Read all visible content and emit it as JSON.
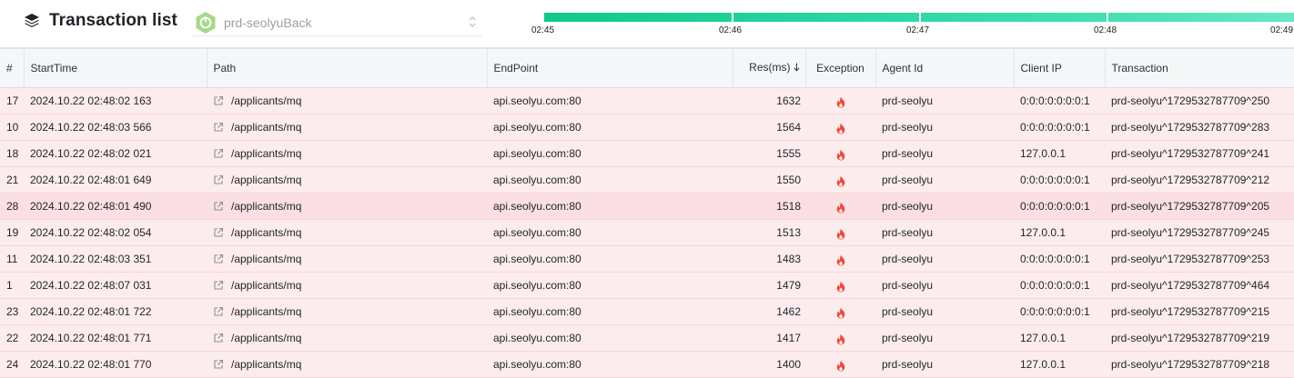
{
  "header": {
    "title": "Transaction list",
    "title_icon": "layers-icon",
    "app_name": "prd-seolyuBack",
    "app_icon": "spring-boot-icon"
  },
  "timeline": {
    "ticks": [
      "02:45",
      "02:46",
      "02:47",
      "02:48",
      "02:49"
    ],
    "colors": [
      "#10c88d",
      "#20d09a",
      "#30d9a6",
      "#45e0b2",
      "#66e8c4"
    ]
  },
  "table": {
    "columns": [
      "#",
      "StartTime",
      "Path",
      "EndPoint",
      "Res(ms)",
      "Exception",
      "Agent Id",
      "Client IP",
      "Transaction"
    ],
    "sort_icon": "arrow-down-icon",
    "rows": [
      {
        "id": "17",
        "start": "2024.10.22 02:48:02 163",
        "path": "/applicants/mq",
        "endpoint": "api.seolyu.com:80",
        "res": "1632",
        "agent": "prd-seolyu",
        "ip": "0:0:0:0:0:0:0:1",
        "tx": "prd-seolyu^1729532787709^250"
      },
      {
        "id": "10",
        "start": "2024.10.22 02:48:03 566",
        "path": "/applicants/mq",
        "endpoint": "api.seolyu.com:80",
        "res": "1564",
        "agent": "prd-seolyu",
        "ip": "0:0:0:0:0:0:0:1",
        "tx": "prd-seolyu^1729532787709^283"
      },
      {
        "id": "18",
        "start": "2024.10.22 02:48:02 021",
        "path": "/applicants/mq",
        "endpoint": "api.seolyu.com:80",
        "res": "1555",
        "agent": "prd-seolyu",
        "ip": "127.0.0.1",
        "tx": "prd-seolyu^1729532787709^241"
      },
      {
        "id": "21",
        "start": "2024.10.22 02:48:01 649",
        "path": "/applicants/mq",
        "endpoint": "api.seolyu.com:80",
        "res": "1550",
        "agent": "prd-seolyu",
        "ip": "0:0:0:0:0:0:0:1",
        "tx": "prd-seolyu^1729532787709^212"
      },
      {
        "id": "28",
        "start": "2024.10.22 02:48:01 490",
        "path": "/applicants/mq",
        "endpoint": "api.seolyu.com:80",
        "res": "1518",
        "agent": "prd-seolyu",
        "ip": "0:0:0:0:0:0:0:1",
        "tx": "prd-seolyu^1729532787709^205"
      },
      {
        "id": "19",
        "start": "2024.10.22 02:48:02 054",
        "path": "/applicants/mq",
        "endpoint": "api.seolyu.com:80",
        "res": "1513",
        "agent": "prd-seolyu",
        "ip": "127.0.0.1",
        "tx": "prd-seolyu^1729532787709^245"
      },
      {
        "id": "11",
        "start": "2024.10.22 02:48:03 351",
        "path": "/applicants/mq",
        "endpoint": "api.seolyu.com:80",
        "res": "1483",
        "agent": "prd-seolyu",
        "ip": "0:0:0:0:0:0:0:1",
        "tx": "prd-seolyu^1729532787709^253"
      },
      {
        "id": "1",
        "start": "2024.10.22 02:48:07 031",
        "path": "/applicants/mq",
        "endpoint": "api.seolyu.com:80",
        "res": "1479",
        "agent": "prd-seolyu",
        "ip": "0:0:0:0:0:0:0:1",
        "tx": "prd-seolyu^1729532787709^464"
      },
      {
        "id": "23",
        "start": "2024.10.22 02:48:01 722",
        "path": "/applicants/mq",
        "endpoint": "api.seolyu.com:80",
        "res": "1462",
        "agent": "prd-seolyu",
        "ip": "0:0:0:0:0:0:0:1",
        "tx": "prd-seolyu^1729532787709^215"
      },
      {
        "id": "22",
        "start": "2024.10.22 02:48:01 771",
        "path": "/applicants/mq",
        "endpoint": "api.seolyu.com:80",
        "res": "1417",
        "agent": "prd-seolyu",
        "ip": "127.0.0.1",
        "tx": "prd-seolyu^1729532787709^219"
      },
      {
        "id": "24",
        "start": "2024.10.22 02:48:01 770",
        "path": "/applicants/mq",
        "endpoint": "api.seolyu.com:80",
        "res": "1400",
        "agent": "prd-seolyu",
        "ip": "127.0.0.1",
        "tx": "prd-seolyu^1729532787709^218"
      }
    ]
  }
}
